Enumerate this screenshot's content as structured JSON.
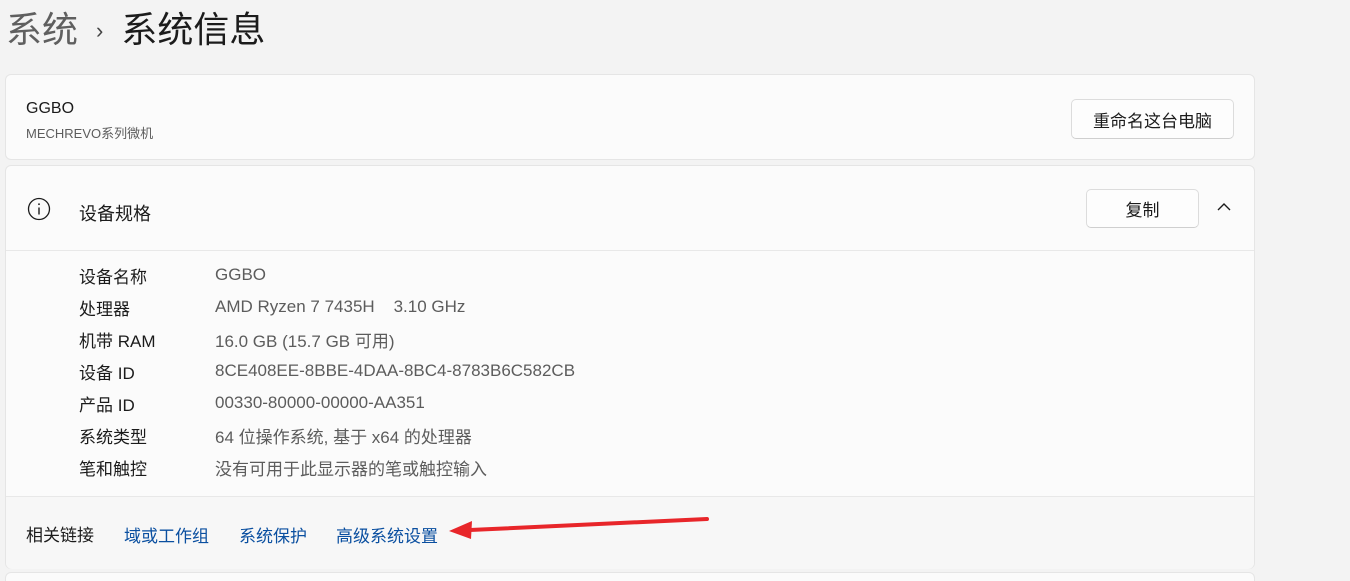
{
  "breadcrumb": {
    "parent": "系统",
    "separator": "›",
    "current": "系统信息"
  },
  "device": {
    "name": "GGBO",
    "model": "MECHREVO系列微机",
    "rename_button": "重命名这台电脑"
  },
  "specs": {
    "icon": "info-icon",
    "title": "设备规格",
    "copy_button": "复制",
    "collapse_icon": "chevron-up-icon",
    "rows": [
      {
        "label": "设备名称",
        "value": "GGBO"
      },
      {
        "label": "处理器",
        "value": "AMD Ryzen 7 7435H    3.10 GHz"
      },
      {
        "label": "机带 RAM",
        "value": "16.0 GB (15.7 GB 可用)"
      },
      {
        "label": "设备 ID",
        "value": "8CE408EE-8BBE-4DAA-8BC4-8783B6C582CB"
      },
      {
        "label": "产品 ID",
        "value": "00330-80000-00000-AA351"
      },
      {
        "label": "系统类型",
        "value": "64 位操作系统, 基于 x64 的处理器"
      },
      {
        "label": "笔和触控",
        "value": "没有可用于此显示器的笔或触控输入"
      }
    ]
  },
  "related": {
    "label": "相关链接",
    "links": [
      "域或工作组",
      "系统保护",
      "高级系统设置"
    ]
  },
  "annotation": {
    "arrow_color": "#e8262a",
    "target": "高级系统设置"
  }
}
